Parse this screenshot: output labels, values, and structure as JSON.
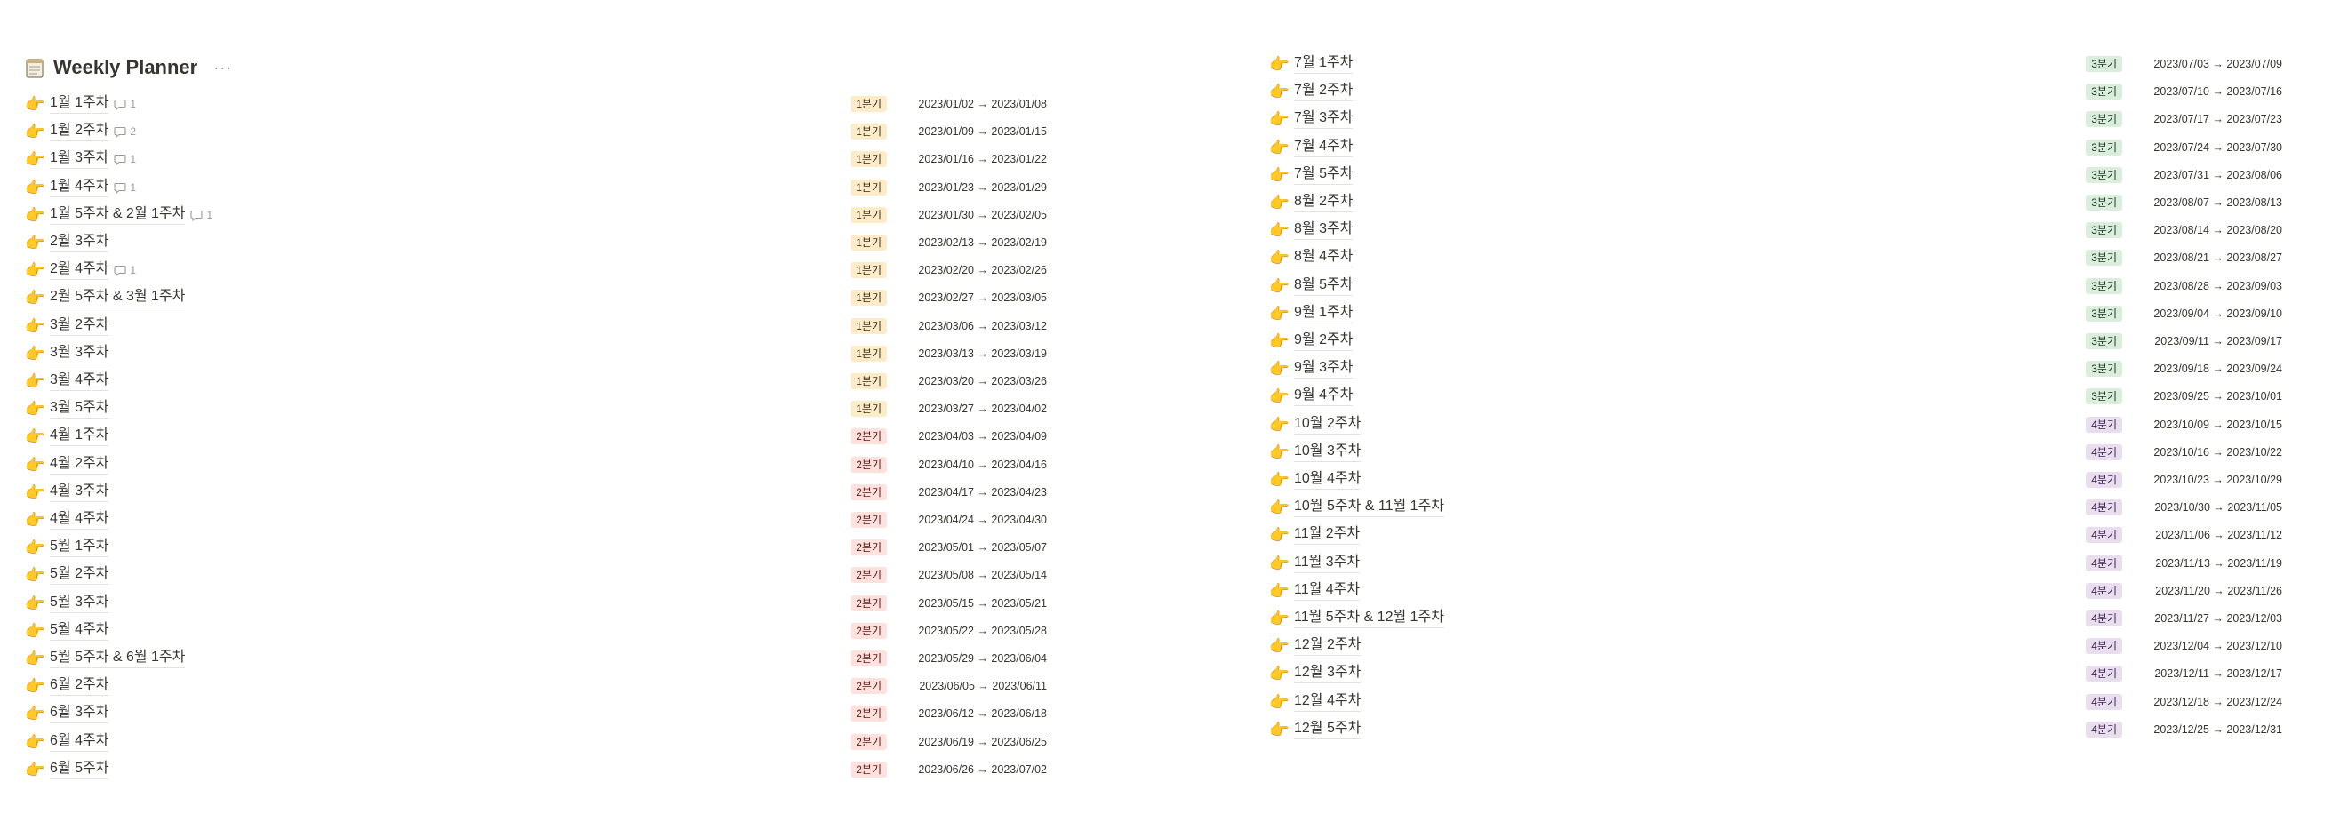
{
  "page": {
    "title": "Weekly Planner",
    "more_label": "···"
  },
  "colors": {
    "q1": "#fdecc8",
    "q2": "#ffe2dd",
    "q3": "#dbeddb",
    "q4": "#e8deee"
  },
  "left_rows": [
    {
      "name": "1월 1주차",
      "comments": "1",
      "quarter": "1분기",
      "dates": "2023/01/02 → 2023/01/08"
    },
    {
      "name": "1월 2주차",
      "comments": "2",
      "quarter": "1분기",
      "dates": "2023/01/09 → 2023/01/15"
    },
    {
      "name": "1월 3주차",
      "comments": "1",
      "quarter": "1분기",
      "dates": "2023/01/16 → 2023/01/22"
    },
    {
      "name": "1월 4주차",
      "comments": "1",
      "quarter": "1분기",
      "dates": "2023/01/23 → 2023/01/29"
    },
    {
      "name": "1월 5주차 & 2월 1주차",
      "comments": "1",
      "quarter": "1분기",
      "dates": "2023/01/30 → 2023/02/05"
    },
    {
      "name": "2월 3주차",
      "comments": "",
      "quarter": "1분기",
      "dates": "2023/02/13 → 2023/02/19"
    },
    {
      "name": "2월 4주차",
      "comments": "1",
      "quarter": "1분기",
      "dates": "2023/02/20 → 2023/02/26"
    },
    {
      "name": "2월 5주차 & 3월 1주차",
      "comments": "",
      "quarter": "1분기",
      "dates": "2023/02/27 → 2023/03/05"
    },
    {
      "name": "3월 2주차",
      "comments": "",
      "quarter": "1분기",
      "dates": "2023/03/06 → 2023/03/12"
    },
    {
      "name": "3월 3주차",
      "comments": "",
      "quarter": "1분기",
      "dates": "2023/03/13 → 2023/03/19"
    },
    {
      "name": "3월 4주차",
      "comments": "",
      "quarter": "1분기",
      "dates": "2023/03/20 → 2023/03/26"
    },
    {
      "name": "3월 5주차",
      "comments": "",
      "quarter": "1분기",
      "dates": "2023/03/27 → 2023/04/02"
    },
    {
      "name": "4월 1주차",
      "comments": "",
      "quarter": "2분기",
      "dates": "2023/04/03 → 2023/04/09"
    },
    {
      "name": "4월 2주차",
      "comments": "",
      "quarter": "2분기",
      "dates": "2023/04/10 → 2023/04/16"
    },
    {
      "name": "4월 3주차",
      "comments": "",
      "quarter": "2분기",
      "dates": "2023/04/17 → 2023/04/23"
    },
    {
      "name": "4월 4주차",
      "comments": "",
      "quarter": "2분기",
      "dates": "2023/04/24 → 2023/04/30"
    },
    {
      "name": "5월 1주차",
      "comments": "",
      "quarter": "2분기",
      "dates": "2023/05/01 → 2023/05/07"
    },
    {
      "name": "5월 2주차",
      "comments": "",
      "quarter": "2분기",
      "dates": "2023/05/08 → 2023/05/14"
    },
    {
      "name": "5월 3주차",
      "comments": "",
      "quarter": "2분기",
      "dates": "2023/05/15 → 2023/05/21"
    },
    {
      "name": "5월 4주차",
      "comments": "",
      "quarter": "2분기",
      "dates": "2023/05/22 → 2023/05/28"
    },
    {
      "name": "5월 5주차 & 6월 1주차",
      "comments": "",
      "quarter": "2분기",
      "dates": "2023/05/29 → 2023/06/04"
    },
    {
      "name": "6월 2주차",
      "comments": "",
      "quarter": "2분기",
      "dates": "2023/06/05 → 2023/06/11"
    },
    {
      "name": "6월 3주차",
      "comments": "",
      "quarter": "2분기",
      "dates": "2023/06/12 → 2023/06/18"
    },
    {
      "name": "6월 4주차",
      "comments": "",
      "quarter": "2분기",
      "dates": "2023/06/19 → 2023/06/25"
    },
    {
      "name": "6월 5주차",
      "comments": "",
      "quarter": "2분기",
      "dates": "2023/06/26 → 2023/07/02"
    }
  ],
  "right_rows": [
    {
      "name": "7월 1주차",
      "comments": "",
      "quarter": "3분기",
      "dates": "2023/07/03 → 2023/07/09"
    },
    {
      "name": "7월 2주차",
      "comments": "",
      "quarter": "3분기",
      "dates": "2023/07/10 → 2023/07/16"
    },
    {
      "name": "7월 3주차",
      "comments": "",
      "quarter": "3분기",
      "dates": "2023/07/17 → 2023/07/23"
    },
    {
      "name": "7월 4주차",
      "comments": "",
      "quarter": "3분기",
      "dates": "2023/07/24 → 2023/07/30"
    },
    {
      "name": "7월 5주차",
      "comments": "",
      "quarter": "3분기",
      "dates": "2023/07/31 → 2023/08/06"
    },
    {
      "name": "8월 2주차",
      "comments": "",
      "quarter": "3분기",
      "dates": "2023/08/07 → 2023/08/13"
    },
    {
      "name": "8월 3주차",
      "comments": "",
      "quarter": "3분기",
      "dates": "2023/08/14 → 2023/08/20"
    },
    {
      "name": "8월 4주차",
      "comments": "",
      "quarter": "3분기",
      "dates": "2023/08/21 → 2023/08/27"
    },
    {
      "name": "8월 5주차",
      "comments": "",
      "quarter": "3분기",
      "dates": "2023/08/28 → 2023/09/03"
    },
    {
      "name": "9월 1주차",
      "comments": "",
      "quarter": "3분기",
      "dates": "2023/09/04 → 2023/09/10"
    },
    {
      "name": "9월 2주차",
      "comments": "",
      "quarter": "3분기",
      "dates": "2023/09/11 → 2023/09/17"
    },
    {
      "name": "9월 3주차",
      "comments": "",
      "quarter": "3분기",
      "dates": "2023/09/18 → 2023/09/24"
    },
    {
      "name": "9월 4주차",
      "comments": "",
      "quarter": "3분기",
      "dates": "2023/09/25 → 2023/10/01"
    },
    {
      "name": "10월 2주차",
      "comments": "",
      "quarter": "4분기",
      "dates": "2023/10/09 → 2023/10/15"
    },
    {
      "name": "10월 3주차",
      "comments": "",
      "quarter": "4분기",
      "dates": "2023/10/16 → 2023/10/22"
    },
    {
      "name": "10월 4주차",
      "comments": "",
      "quarter": "4분기",
      "dates": "2023/10/23 → 2023/10/29"
    },
    {
      "name": "10월 5주차 & 11월 1주차",
      "comments": "",
      "quarter": "4분기",
      "dates": "2023/10/30 → 2023/11/05"
    },
    {
      "name": "11월 2주차",
      "comments": "",
      "quarter": "4분기",
      "dates": "2023/11/06 → 2023/11/12"
    },
    {
      "name": "11월 3주차",
      "comments": "",
      "quarter": "4분기",
      "dates": "2023/11/13 → 2023/11/19"
    },
    {
      "name": "11월 4주차",
      "comments": "",
      "quarter": "4분기",
      "dates": "2023/11/20 → 2023/11/26"
    },
    {
      "name": "11월 5주차 & 12월 1주차",
      "comments": "",
      "quarter": "4분기",
      "dates": "2023/11/27 → 2023/12/03"
    },
    {
      "name": "12월 2주차",
      "comments": "",
      "quarter": "4분기",
      "dates": "2023/12/04 → 2023/12/10"
    },
    {
      "name": "12월 3주차",
      "comments": "",
      "quarter": "4분기",
      "dates": "2023/12/11 → 2023/12/17"
    },
    {
      "name": "12월 4주차",
      "comments": "",
      "quarter": "4분기",
      "dates": "2023/12/18 → 2023/12/24"
    },
    {
      "name": "12월 5주차",
      "comments": "",
      "quarter": "4분기",
      "dates": "2023/12/25 → 2023/12/31"
    }
  ]
}
